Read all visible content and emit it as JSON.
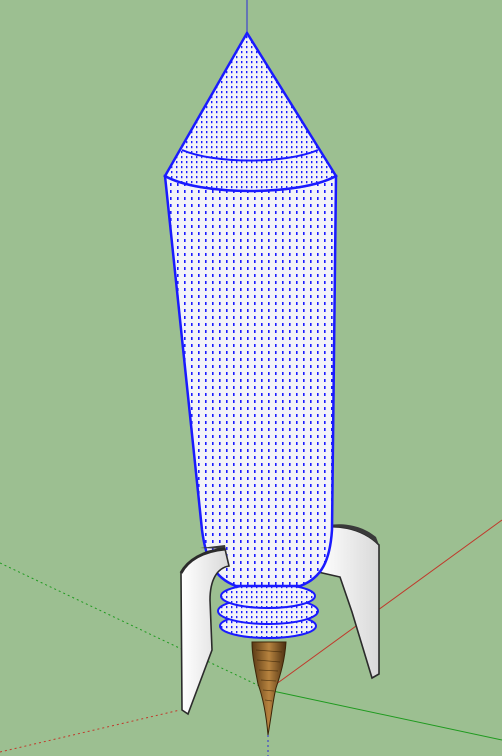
{
  "viewport": {
    "background_color": "#9cbf91",
    "selection_color": "#1a1aff",
    "axis_colors": {
      "red": "#c0392b",
      "green": "#1f9a1f",
      "blue": "#2b2bd6"
    }
  },
  "model": {
    "name_icon": "rocket-model-icon",
    "state": "selected",
    "body_color": "#f3f3f8",
    "fin_color": "#f2f2f2",
    "fin_edge_color": "#2b2b2b",
    "exhaust_color": "#9a6a2f"
  }
}
